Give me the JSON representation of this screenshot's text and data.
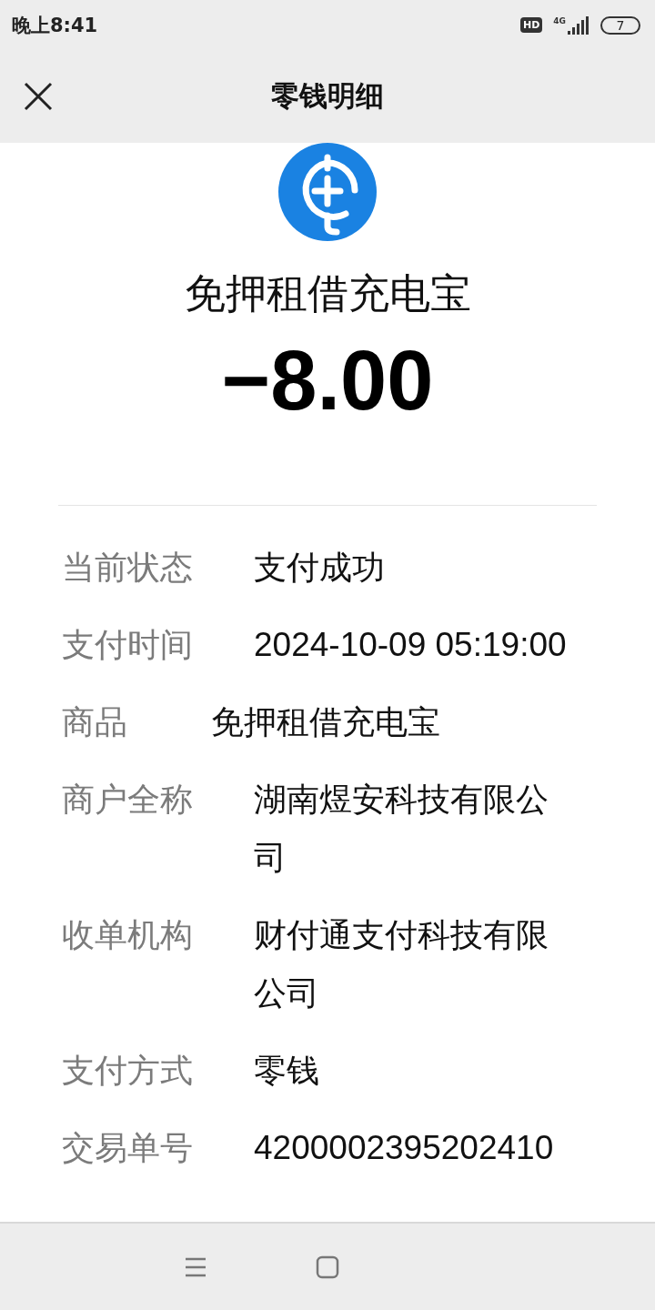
{
  "status_bar": {
    "time": "晚上8:41",
    "hd_badge": "HD",
    "network": "4G",
    "battery": "7"
  },
  "header": {
    "title": "零钱明细"
  },
  "merchant": {
    "name": "免押租借充电宝"
  },
  "amount": "−8.00",
  "details": [
    {
      "kind": "text",
      "label": "当前状态",
      "value": "支付成功"
    },
    {
      "kind": "number",
      "label": "支付时间",
      "value": "2024-10-09 05:19:00"
    },
    {
      "kind": "inline",
      "label": "商品",
      "value": "免押租借充电宝"
    },
    {
      "kind": "text",
      "label": "商户全称",
      "value": "湖南煜安科技有限公司"
    },
    {
      "kind": "text",
      "label": "收单机构",
      "value": "财付通支付科技有限公司"
    },
    {
      "kind": "text",
      "label": "支付方式",
      "value": "零钱"
    },
    {
      "kind": "number",
      "label": "交易单号",
      "value": "4200002395202410"
    }
  ]
}
